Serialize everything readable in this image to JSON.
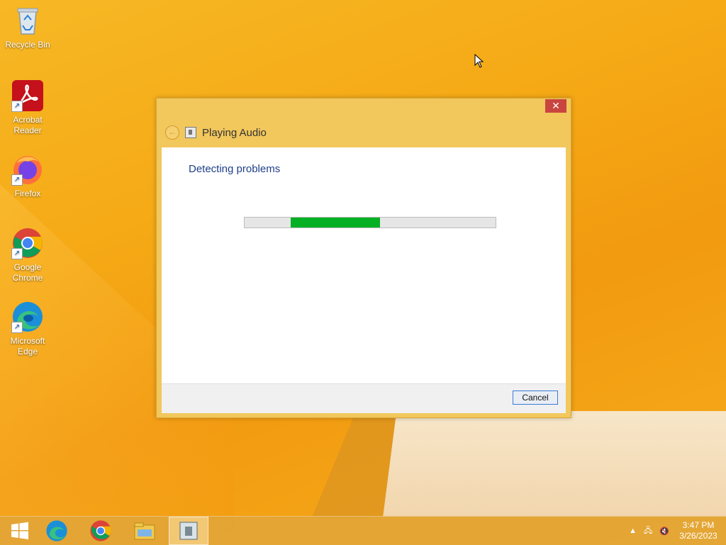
{
  "desktop": {
    "icons": [
      {
        "label_line1": "Recycle Bin",
        "label_line2": "",
        "icon": "recycle-bin-icon"
      },
      {
        "label_line1": "Acrobat",
        "label_line2": "Reader",
        "icon": "acrobat-reader-icon"
      },
      {
        "label_line1": "Firefox",
        "label_line2": "",
        "icon": "firefox-icon"
      },
      {
        "label_line1": "Google",
        "label_line2": "Chrome",
        "icon": "chrome-icon"
      },
      {
        "label_line1": "Microsoft",
        "label_line2": "Edge",
        "icon": "edge-icon"
      }
    ]
  },
  "dialog": {
    "title": "Playing Audio",
    "heading": "Detecting problems",
    "close_glyph": "✕",
    "back_glyph": "←",
    "progress": {
      "fill_start": 0.185,
      "fill_end": 0.54,
      "color": "#06b025"
    },
    "cancel_label": "Cancel"
  },
  "taskbar": {
    "apps": [
      "start-icon",
      "edge-icon",
      "chrome-icon",
      "file-explorer-icon",
      "troubleshooter-icon"
    ],
    "tray": {
      "up_arrow": "▲",
      "network_glyph": "🖧",
      "volume_glyph": "🔇"
    },
    "clock": {
      "time": "3:47 PM",
      "date": "3/26/2023"
    }
  },
  "colors": {
    "accent": "#f2c75c",
    "close": "#c9453f",
    "heading": "#1e3f8a"
  }
}
